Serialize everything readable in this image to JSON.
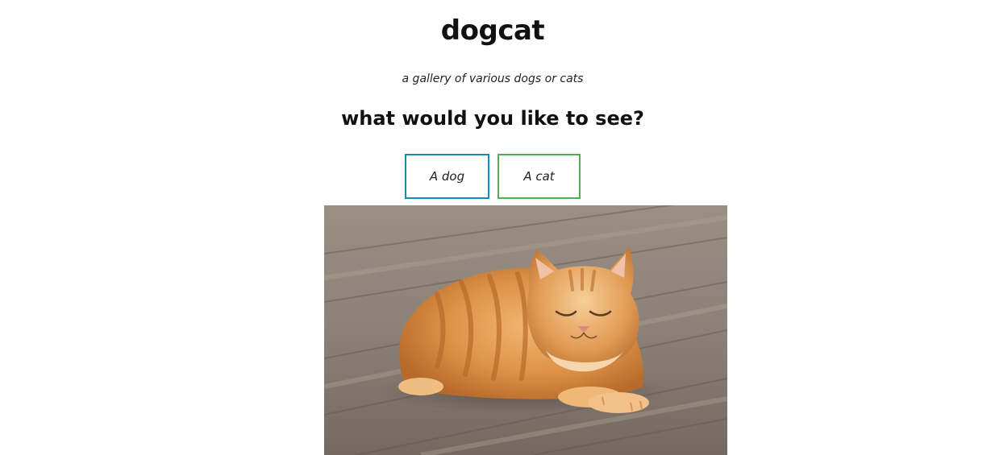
{
  "site": {
    "title": "dogcat",
    "tagline": "a gallery of various dogs or cats"
  },
  "prompt": {
    "question": "what would you like to see?"
  },
  "choices": [
    {
      "label": "A dog",
      "border_color": "#1a8ab5"
    },
    {
      "label": "A cat",
      "border_color": "#4caf50"
    }
  ],
  "image": {
    "subject": "orange tabby cat lying on wooden floor"
  }
}
